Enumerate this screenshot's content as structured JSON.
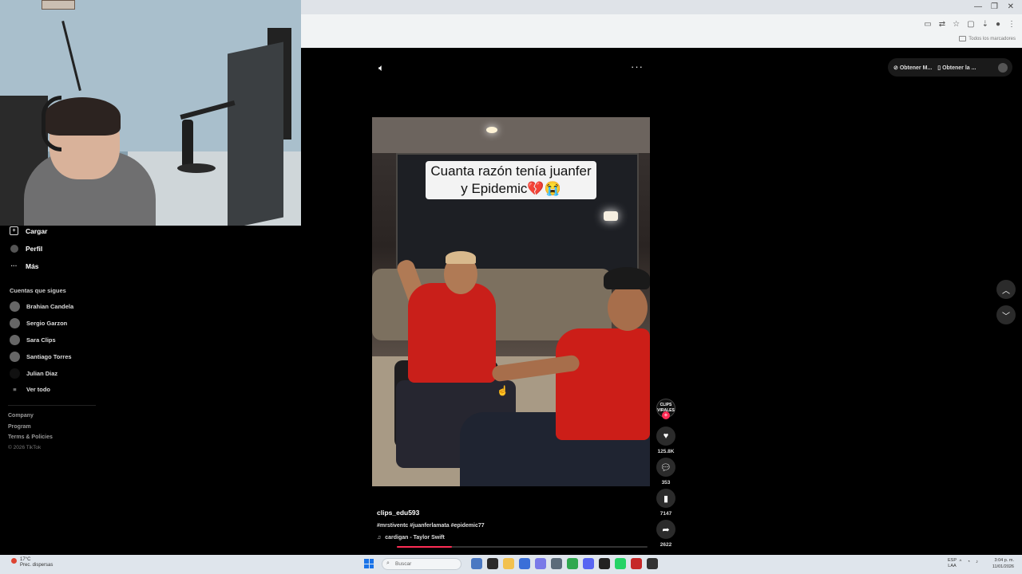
{
  "browser": {
    "toolbar_icons": [
      "monitor-icon",
      "translate-icon",
      "star-icon",
      "extensions-icon",
      "profile-icon",
      "menu-icon"
    ],
    "bookmarks_label": "Todos los marcadores"
  },
  "sidebar": {
    "nav": [
      {
        "label": "Cargar",
        "icon": "upload-icon"
      },
      {
        "label": "Perfil",
        "icon": "profile-icon"
      },
      {
        "label": "Más",
        "icon": "more-icon"
      }
    ],
    "following_title": "Cuentas que sigues",
    "following": [
      {
        "name": "Brahian Candela"
      },
      {
        "name": "Sergio Garzon"
      },
      {
        "name": "Sara Clips"
      },
      {
        "name": "Santiago Torres"
      },
      {
        "name": "Julian Diaz"
      }
    ],
    "see_all": "Ver todo",
    "footer_links": [
      "Company",
      "Program",
      "Terms & Policies"
    ],
    "copyright": "© 2026 TikTok"
  },
  "player": {
    "ext_buttons": [
      "Obtener M...",
      "Obtener la ..."
    ],
    "video_caption_line1": "Cuanta razón tenía juanfer",
    "video_caption_line2": "y Epidemic💔😭",
    "author": "clips_edu593",
    "hashtags": "#mrstiventc #juanferlamata #epidemic77",
    "music": "cardigan - Taylor Swift",
    "progress": 0.22
  },
  "actions": {
    "creator_label": "CLIPS VIRALES",
    "likes": "125.8K",
    "comments": "353",
    "saves": "7147",
    "shares": "2622"
  },
  "taskbar": {
    "weather_temp": "17°C",
    "weather_desc": "Prec. dispersas",
    "search_placeholder": "Buscar",
    "lang_line1": "ESP",
    "lang_line2": "LAA",
    "time": "3:04 p. m.",
    "date": "11/01/2026"
  }
}
